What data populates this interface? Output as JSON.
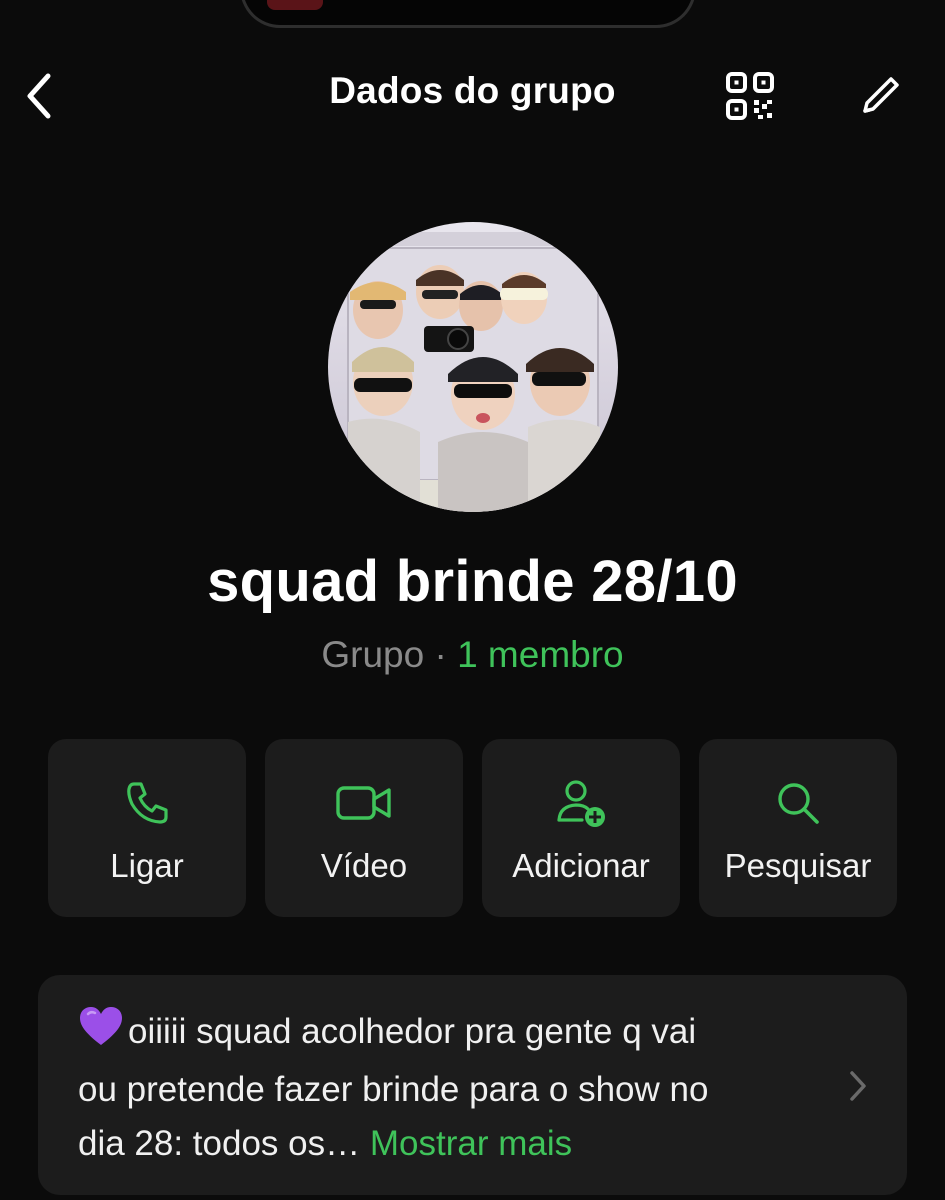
{
  "header": {
    "title": "Dados do grupo",
    "back_icon": "chevron-left-icon",
    "qr_icon": "qr-code-icon",
    "edit_icon": "pencil-icon"
  },
  "group": {
    "name": "squad brinde 28/10",
    "type": "Grupo",
    "separator": "·",
    "members": "1 membro"
  },
  "actions": [
    {
      "label": "Ligar",
      "icon": "phone-icon"
    },
    {
      "label": "Vídeo",
      "icon": "video-camera-icon"
    },
    {
      "label": "Adicionar",
      "icon": "add-user-icon"
    },
    {
      "label": "Pesquisar",
      "icon": "search-icon"
    }
  ],
  "description": {
    "text_line1": "oiiiii squad acolhedor pra gente q vai",
    "text_line2": "ou pretende fazer brinde para o show no",
    "text_line3": "dia 28: todos os…",
    "more_link": "Mostrar mais",
    "emoji_icon": "purple-heart-icon"
  },
  "colors": {
    "background": "#0b0b0b",
    "card": "#1c1c1c",
    "accent": "#3fc35a",
    "secondary_text": "#8a8a8a"
  }
}
